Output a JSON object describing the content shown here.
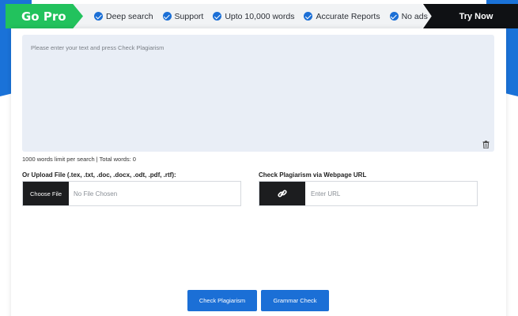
{
  "banner": {
    "go_pro": "Go Pro",
    "features": [
      "Deep search",
      "Support",
      "Upto 10,000 words",
      "Accurate Reports",
      "No ads"
    ],
    "try_now": "Try Now"
  },
  "editor": {
    "placeholder": "Please enter your text and press Check Plagiarism",
    "counter": "1000 words limit per search | Total words: 0"
  },
  "upload": {
    "label": "Or Upload File (.tex, .txt, .doc, .docx, .odt, .pdf, .rtf):",
    "button": "Choose File",
    "status": "No File Chosen"
  },
  "url": {
    "label": "Check Plagiarism via Webpage URL",
    "placeholder": "Enter URL"
  },
  "actions": {
    "check_plagiarism": "Check Plagiarism",
    "grammar_check": "Grammar Check"
  },
  "colors": {
    "accent_blue": "#1b6fd6",
    "go_pro_green": "#22c25d",
    "dark": "#1c1d1f",
    "editor_bg": "#e9eef6"
  },
  "icons": {
    "feature": "check-circle-icon",
    "delete": "trash-icon",
    "url": "link-icon"
  }
}
